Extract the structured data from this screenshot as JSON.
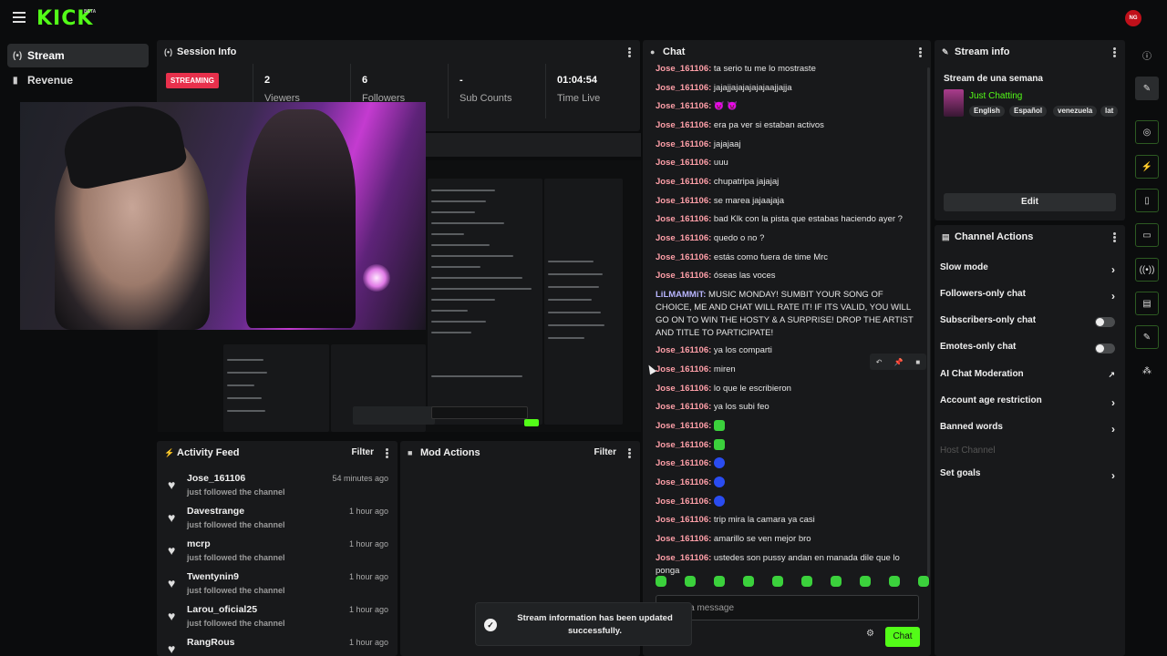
{
  "brand": {
    "logo": "KICK",
    "beta": "BETA",
    "avatar_text": "NG",
    "accent": "#53fc18"
  },
  "sidebar": {
    "items": [
      {
        "label": "Stream",
        "icon": "broadcast-icon"
      },
      {
        "label": "Revenue",
        "icon": "chart-icon"
      }
    ]
  },
  "session": {
    "title": "Session Info",
    "status": "STREAMING",
    "status_label": "Session",
    "stats": [
      {
        "value": "2",
        "label": "Viewers"
      },
      {
        "value": "6",
        "label": "Followers"
      },
      {
        "value": "-",
        "label": "Sub Counts"
      },
      {
        "value": "01:04:54",
        "label": "Time Live"
      }
    ]
  },
  "chat": {
    "title": "Chat",
    "messages": [
      {
        "user": "Jose_161106:",
        "text": " ta serio tu me lo mostraste"
      },
      {
        "user": "Jose_161106:",
        "text": " jajajjajajajajajaajjajja"
      },
      {
        "user": "Jose_161106:",
        "text": " 👿 👿"
      },
      {
        "user": "Jose_161106:",
        "text": " era pa ver si estaban activos"
      },
      {
        "user": "Jose_161106:",
        "text": " jajajaaj"
      },
      {
        "user": "Jose_161106:",
        "text": " uuu"
      },
      {
        "user": "Jose_161106:",
        "text": " chupatripa jajajaj"
      },
      {
        "user": "Jose_161106:",
        "text": " se marea jajaajaja"
      },
      {
        "user": "Jose_161106:",
        "text": " bad Klk con la pista que estabas haciendo ayer ?"
      },
      {
        "user": "Jose_161106:",
        "text": " quedo o no ?"
      },
      {
        "user": "Jose_161106:",
        "text": " estás como fuera de time Mrc"
      },
      {
        "user": "Jose_161106:",
        "text": " óseas las voces"
      },
      {
        "user": "LiLMAMMiT:",
        "text": " MUSIC MONDAY! SUMBIT YOUR SONG OF CHOICE, ME AND CHAT WILL RATE IT! IF ITS VALID, YOU WILL GO ON TO WIN THE HOSTY & A SURPRISE! DROP THE ARTIST AND TITLE TO PARTICIPATE!"
      },
      {
        "user": "Jose_161106:",
        "text": " ya los comparti"
      },
      {
        "user": "Jose_161106:",
        "text": " miren"
      },
      {
        "user": "Jose_161106:",
        "text": " lo que le escribieron"
      },
      {
        "user": "Jose_161106:",
        "text": " ya los subi feo"
      },
      {
        "user": "Jose_161106:",
        "text": ""
      },
      {
        "user": "Jose_161106:",
        "text": ""
      },
      {
        "user": "Jose_161106:",
        "text": ""
      },
      {
        "user": "Jose_161106:",
        "text": ""
      },
      {
        "user": "Jose_161106:",
        "text": ""
      },
      {
        "user": "Jose_161106:",
        "text": " trip mira la camara ya casi"
      },
      {
        "user": "Jose_161106:",
        "text": " amarillo se ven mejor bro"
      },
      {
        "user": "Jose_161106:",
        "text": " ustedes son pussy andan en manada dile que lo ponga"
      }
    ],
    "placeholder": "Send a message",
    "send_label": "Chat"
  },
  "stream_info": {
    "title": "Stream info",
    "stream_title": "Stream de una semana",
    "category": "Just Chatting",
    "tags": [
      "English",
      "Español",
      "venezuela",
      "lat"
    ],
    "edit_label": "Edit"
  },
  "channel_actions": {
    "title": "Channel Actions",
    "items": [
      {
        "label": "Slow mode",
        "control": "arrow"
      },
      {
        "label": "Followers-only chat",
        "control": "arrow"
      },
      {
        "label": "Subscribers-only chat",
        "control": "toggle"
      },
      {
        "label": "Emotes-only chat",
        "control": "toggle"
      },
      {
        "label": "AI Chat Moderation",
        "control": "external"
      },
      {
        "label": "Account age restriction",
        "control": "arrow"
      },
      {
        "label": "Banned words",
        "control": "arrow"
      },
      {
        "label": "Host Channel",
        "control": "disabled"
      },
      {
        "label": "Set goals",
        "control": "arrow"
      }
    ]
  },
  "activity": {
    "title": "Activity Feed",
    "filter": "Filter",
    "items": [
      {
        "name": "Jose_161106",
        "sub": "just followed the channel",
        "time": "54 minutes ago"
      },
      {
        "name": "Davestrange",
        "sub": "just followed the channel",
        "time": "1 hour ago"
      },
      {
        "name": "mcrp",
        "sub": "just followed the channel",
        "time": "1 hour ago"
      },
      {
        "name": "Twentynin9",
        "sub": "just followed the channel",
        "time": "1 hour ago"
      },
      {
        "name": "Larou_oficial25",
        "sub": "just followed the channel",
        "time": "1 hour ago"
      },
      {
        "name": "RangRous",
        "sub": "",
        "time": "1 hour ago"
      }
    ]
  },
  "mod_actions": {
    "title": "Mod Actions",
    "filter": "Filter"
  },
  "toast": {
    "message": "Stream information has been updated successfully."
  }
}
